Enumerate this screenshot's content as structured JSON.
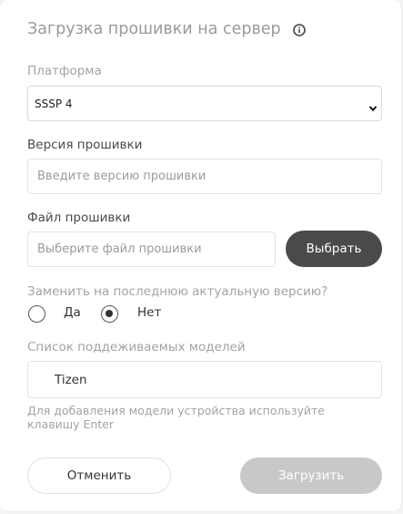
{
  "dialog": {
    "title": "Загрузка прошивки на сервер",
    "info_icon": "info-icon"
  },
  "platform": {
    "label": "Платформа",
    "selected": "SSSP 4"
  },
  "firmware_version": {
    "label": "Версия прошивки",
    "value": "",
    "placeholder": "Введите версию прошивки"
  },
  "firmware_file": {
    "label": "Файл прошивки",
    "value": "",
    "placeholder": "Выберите файл прошивки",
    "choose_button": "Выбрать"
  },
  "replace_latest": {
    "question": "Заменить на последнюю актуальную версию?",
    "options": [
      {
        "label": "Да",
        "checked": false
      },
      {
        "label": "Нет",
        "checked": true
      }
    ]
  },
  "models": {
    "label": "Список поддеживаемых моделей",
    "value": "Tizen",
    "hint": "Для добавления модели устройства используйте клавишу Enter"
  },
  "actions": {
    "cancel": "Отменить",
    "upload": "Загрузить"
  }
}
